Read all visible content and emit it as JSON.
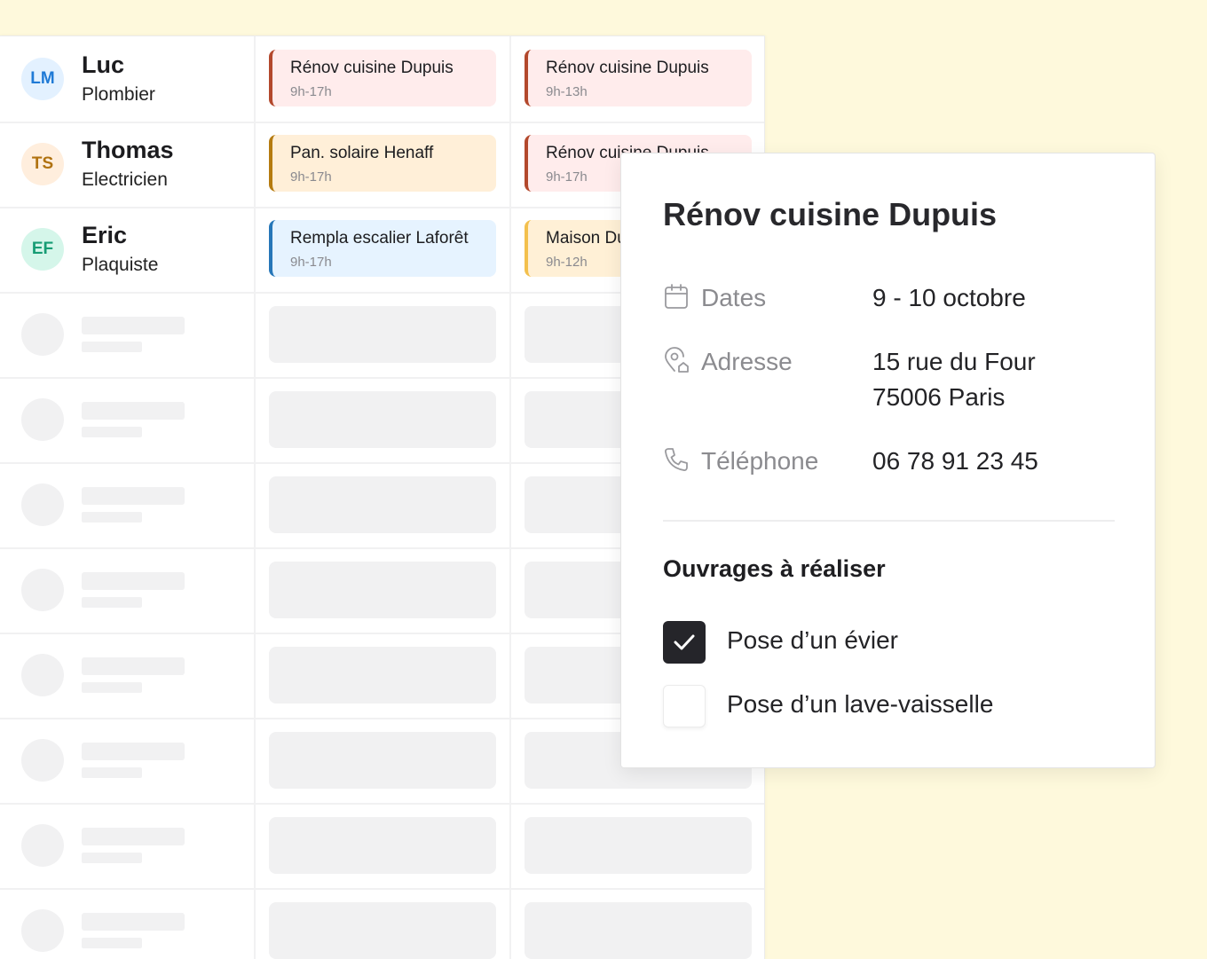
{
  "colors": {
    "background": "#fef9dc",
    "skeleton": "#f1f1f2",
    "checkbox_checked": "#25252a"
  },
  "staff": [
    {
      "initials": "LM",
      "name": "Luc",
      "role": "Plombier",
      "avatar_bg": "#e3f1ff",
      "avatar_fg": "#1f7ad6",
      "cards": [
        {
          "title": "Rénov cuisine Dupuis",
          "hours": "9h-17h",
          "bg": "#ffecec",
          "accent": "#b3482c"
        },
        {
          "title": "Rénov cuisine Dupuis",
          "hours": "9h-13h",
          "bg": "#ffecec",
          "accent": "#b3482c"
        }
      ]
    },
    {
      "initials": "TS",
      "name": "Thomas",
      "role": "Electricien",
      "avatar_bg": "#ffeedd",
      "avatar_fg": "#b07210",
      "cards": [
        {
          "title": "Pan. solaire Henaff",
          "hours": "9h-17h",
          "bg": "#ffefd8",
          "accent": "#b57b10"
        },
        {
          "title": "Rénov cuisine Dupuis",
          "hours": "9h-17h",
          "bg": "#ffecec",
          "accent": "#b3482c"
        }
      ]
    },
    {
      "initials": "EF",
      "name": "Eric",
      "role": "Plaquiste",
      "avatar_bg": "#d5f6ea",
      "avatar_fg": "#169c74",
      "cards": [
        {
          "title": "Rempla escalier Laforêt",
          "hours": "9h-17h",
          "bg": "#e6f3ff",
          "accent": "#2676b8"
        },
        {
          "title": "Maison Dupré",
          "hours": "9h-12h",
          "bg": "#fff0d6",
          "accent": "#f3c04d"
        }
      ]
    }
  ],
  "skeleton_rows": 8,
  "popover": {
    "title": "Rénov cuisine Dupuis",
    "dates": {
      "icon": "calendar-icon",
      "label": "Dates",
      "value": "9 - 10 octobre"
    },
    "address": {
      "icon": "location-home-icon",
      "label": "Adresse",
      "line1": "15 rue du Four",
      "line2": "75006 Paris"
    },
    "phone": {
      "icon": "phone-icon",
      "label": "Téléphone",
      "value": "06 78 91 23 45"
    },
    "section_title": "Ouvrages à réaliser",
    "tasks": [
      {
        "label": "Pose d’un évier",
        "checked": true
      },
      {
        "label": "Pose d’un lave-vaisselle",
        "checked": false
      }
    ]
  }
}
